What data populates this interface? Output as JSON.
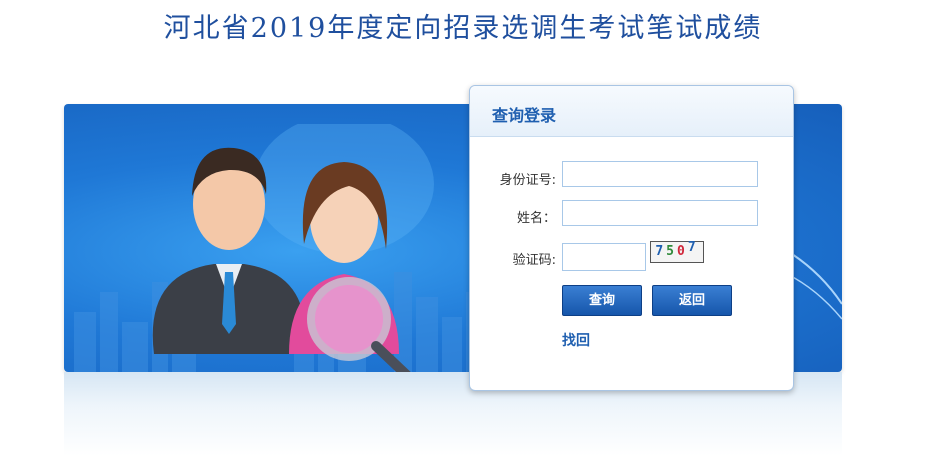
{
  "page": {
    "title": "河北省2019年度定向招录选调生考试笔试成绩"
  },
  "login": {
    "title": "查询登录",
    "fields": [
      {
        "label": "身份证号:",
        "value": "",
        "placeholder": ""
      },
      {
        "label": "姓名：",
        "value": "",
        "placeholder": ""
      },
      {
        "label": "验证码:",
        "value": "",
        "placeholder": ""
      }
    ],
    "captcha": [
      "7",
      "5",
      "0",
      "7"
    ],
    "buttons": {
      "query": "查询",
      "back": "返回"
    },
    "link": "找回"
  },
  "colors": {
    "title": "#1f4f9e",
    "accent": "#1f5fb0",
    "banner": "#1f78d6"
  }
}
